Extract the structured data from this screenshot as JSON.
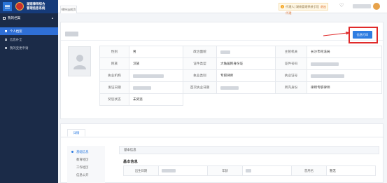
{
  "app": {
    "brand_line1": "湖南律师综合",
    "brand_line2": "管理信息系统",
    "tab": "律所当前页",
    "notice_text": "代理人| 湖南管理系统 [可]",
    "notice_link": "退出代理",
    "brand_color": "#163b7a",
    "accent_color": "#2f7de1"
  },
  "sidebar": {
    "group_label": "我的档案",
    "items": [
      {
        "label": "个人档案",
        "active": true
      },
      {
        "label": "信息补全",
        "active": false
      },
      {
        "label": "我的变更申请",
        "active": false
      }
    ]
  },
  "profile": {
    "print_button": "信息打印",
    "rows": [
      [
        {
          "label": "性别",
          "value": "男"
        },
        {
          "label": "政治面貌",
          "value": ""
        },
        {
          "label": "主管机关",
          "value": "长沙市司法局"
        }
      ],
      [
        {
          "label": "民族",
          "value": "汉族"
        },
        {
          "label": "证件类型",
          "value": "大陆居民身份证"
        },
        {
          "label": "证件号码",
          "value": ""
        }
      ],
      [
        {
          "label": "执业机构",
          "value": ""
        },
        {
          "label": "执业类别",
          "value": "专职律师"
        },
        {
          "label": "执业证号",
          "value": ""
        }
      ],
      [
        {
          "label": "发证日期",
          "value": ""
        },
        {
          "label": "首次执业日期",
          "value": ""
        },
        {
          "label": "所内身份",
          "value": "律所专职律师"
        }
      ],
      [
        {
          "label": "奖惩状态",
          "value": "未奖惩"
        }
      ]
    ]
  },
  "detail": {
    "tab": "详情",
    "subnav": [
      "基础信息",
      "教育经历",
      "工作经历",
      "信息公开"
    ],
    "head": "基本信息",
    "title": "基本信息",
    "fields": [
      {
        "label": "出生日期",
        "value": ""
      },
      {
        "label": "年龄",
        "value": ""
      },
      {
        "label": "曾用名",
        "value": "暂无"
      }
    ]
  }
}
